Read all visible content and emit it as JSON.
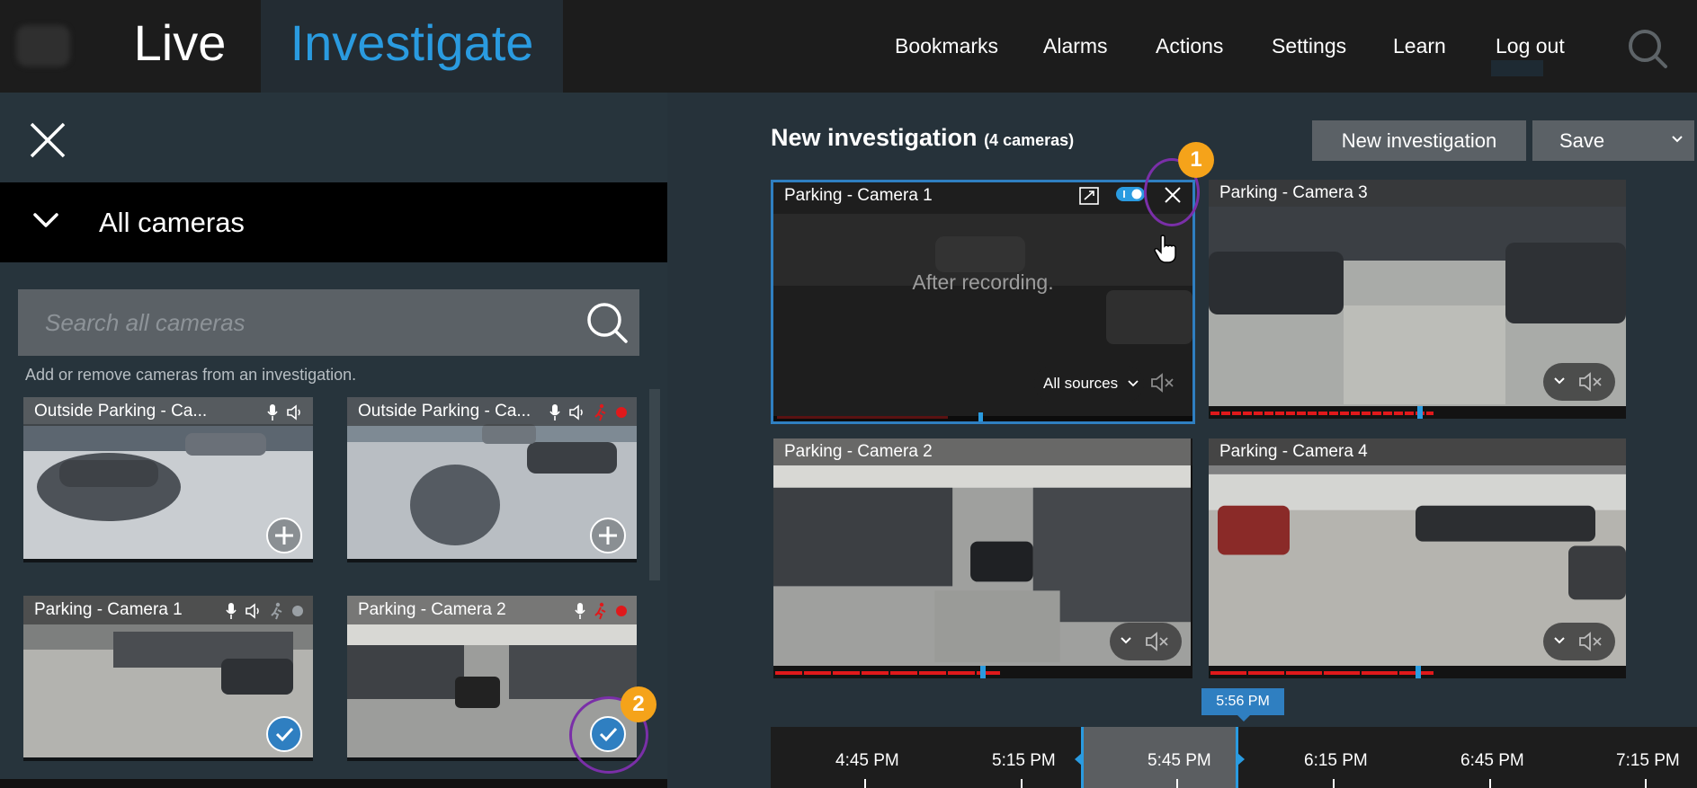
{
  "topbar": {
    "tabs": [
      {
        "label": "Live"
      },
      {
        "label": "Investigate"
      }
    ],
    "nav": [
      {
        "label": "Bookmarks"
      },
      {
        "label": "Alarms"
      },
      {
        "label": "Actions"
      },
      {
        "label": "Settings"
      },
      {
        "label": "Learn"
      },
      {
        "label": "Log out"
      }
    ]
  },
  "left": {
    "group_title": "All cameras",
    "search": {
      "placeholder": "Search all cameras"
    },
    "hint": "Add or remove cameras from an investigation.",
    "thumbnails": [
      {
        "title": "Outside Parking - Ca...",
        "state": "add"
      },
      {
        "title": "Outside Parking - Ca...",
        "state": "add"
      },
      {
        "title": "Parking - Camera 1",
        "state": "selected"
      },
      {
        "title": "Parking - Camera 2",
        "state": "selected"
      }
    ]
  },
  "investigation": {
    "title": "New investigation",
    "count": "(4 cameras)",
    "new_button": "New investigation",
    "save_button": "Save",
    "tiles": [
      {
        "title": "Parking - Camera 1",
        "overlay": "After recording.",
        "sources": "All sources"
      },
      {
        "title": "Parking - Camera 3"
      },
      {
        "title": "Parking - Camera 2"
      },
      {
        "title": "Parking - Camera 4"
      }
    ]
  },
  "annotations": {
    "badge1": "1",
    "badge2": "2"
  },
  "timeline": {
    "current": "5:56 PM",
    "labels": [
      "4:45 PM",
      "5:15 PM",
      "5:45 PM",
      "6:15 PM",
      "6:45 PM",
      "7:15 PM"
    ]
  },
  "colors": {
    "accent": "#2a9be0",
    "record": "#e0191b",
    "badge": "#f5a31a",
    "ring": "#7a2fa8"
  }
}
